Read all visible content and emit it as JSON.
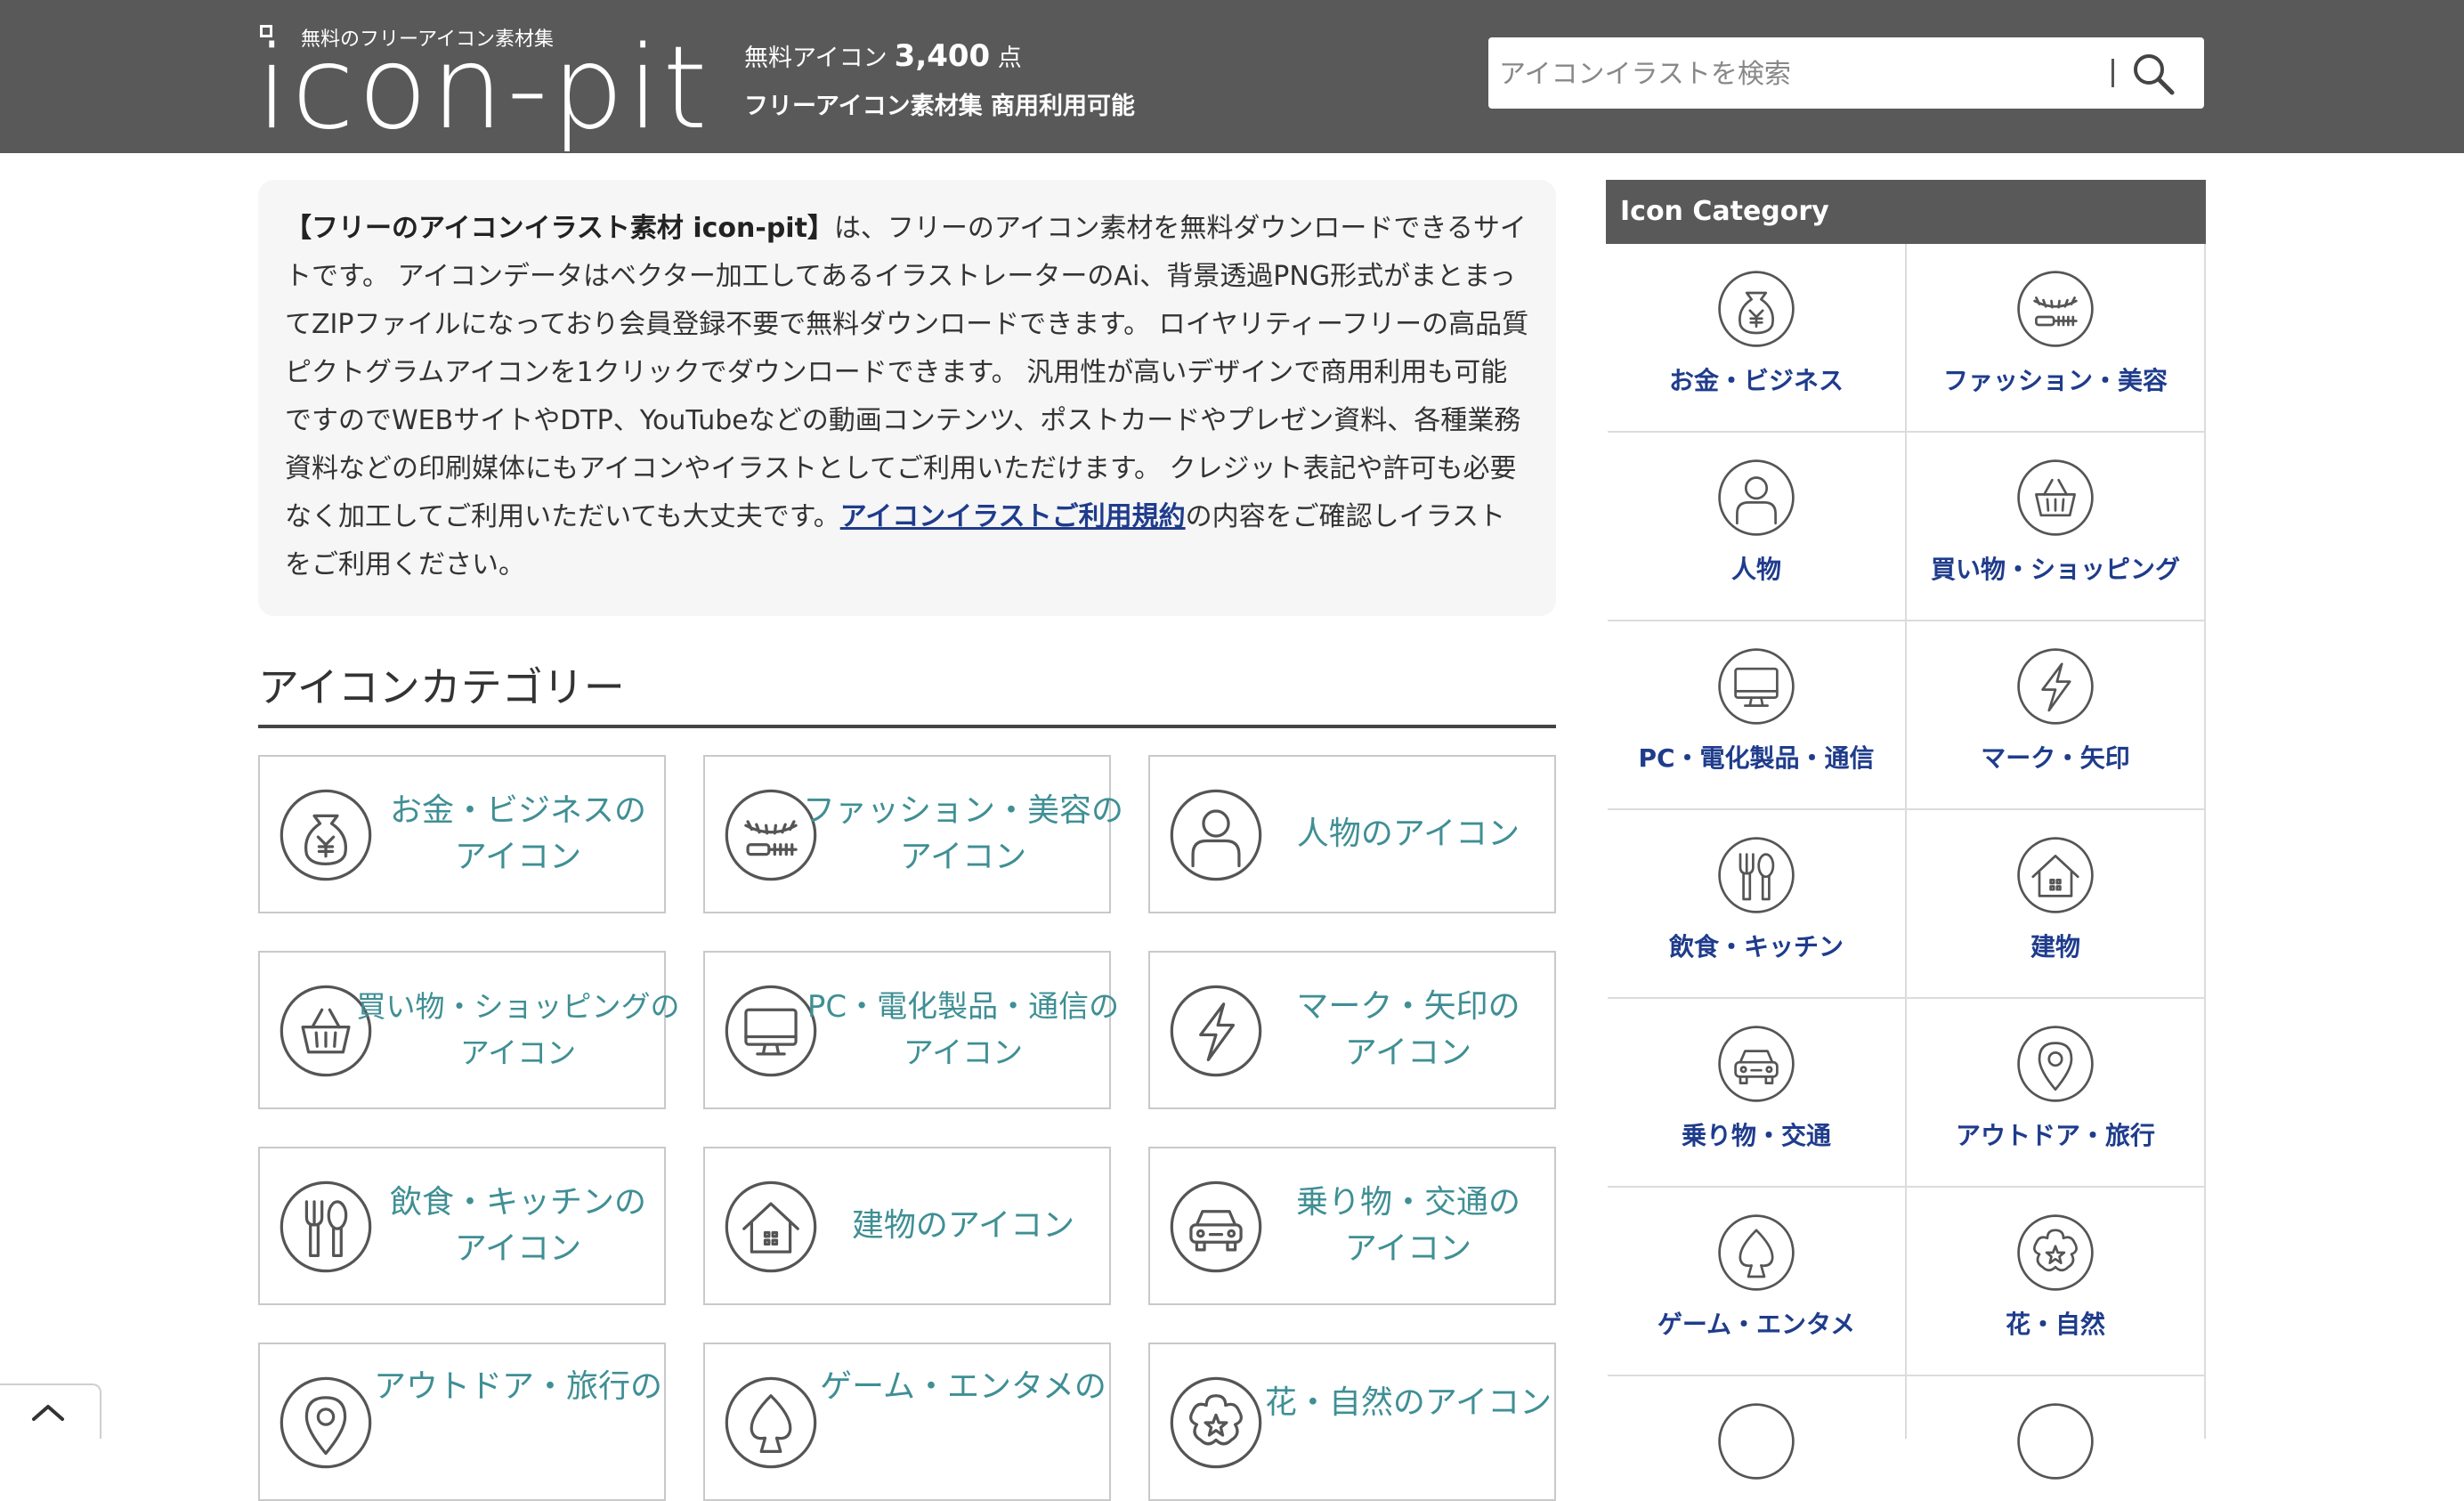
{
  "header": {
    "logo_tagline": "無料のフリーアイコン素材集",
    "logo_text": "icon-pit",
    "count_label": "無料アイコン",
    "count_value": "3,400",
    "count_unit": "点",
    "subline": "フリーアイコン素材集 商用利用可能",
    "search_placeholder": "アイコンイラストを検索"
  },
  "intro": {
    "lead_bold": "【フリーのアイコンイラスト素材 icon-pit】",
    "body_1": "は、フリーのアイコン素材を無料ダウンロードできるサイトです。 アイコンデータはベクター加工してあるイラストレーターのAi、背景透過PNG形式がまとまってZIPファイルになっており会員登録不要で無料ダウンロードできます。 ロイヤリティーフリーの高品質ピクトグラムアイコンを1クリックでダウンロードできます。 汎用性が高いデザインで商用利用も可能ですのでWEBサイトやDTP、YouTubeなどの動画コンテンツ、ポストカードやプレゼン資料、各種業務資料などの印刷媒体にもアイコンやイラストとしてご利用いただけます。 クレジット表記や許可も必要なく加工してご利用いただいても大丈夫です。",
    "link_text": "アイコンイラストご利用規約",
    "body_2": "の内容をご確認しイラストをご利用ください。"
  },
  "section_title": "アイコンカテゴリー",
  "main_categories": [
    {
      "line1": "お金・ビジネスの",
      "line2": "アイコン",
      "icon": "money-bag-icon"
    },
    {
      "line1": "ファッション・美容の",
      "line2": "アイコン",
      "icon": "eyelash-icon"
    },
    {
      "line1": "人物のアイコン",
      "line2": "",
      "icon": "person-icon"
    },
    {
      "line1": "買い物・ショッピングの",
      "line2": "アイコン",
      "icon": "basket-icon"
    },
    {
      "line1": "PC・電化製品・通信の",
      "line2": "アイコン",
      "icon": "monitor-icon"
    },
    {
      "line1": "マーク・矢印の",
      "line2": "アイコン",
      "icon": "lightning-icon"
    },
    {
      "line1": "飲食・キッチンの",
      "line2": "アイコン",
      "icon": "fork-spoon-icon"
    },
    {
      "line1": "建物のアイコン",
      "line2": "",
      "icon": "house-icon"
    },
    {
      "line1": "乗り物・交通の",
      "line2": "アイコン",
      "icon": "car-icon"
    },
    {
      "line1": "アウトドア・旅行の",
      "line2": "",
      "icon": "map-pin-icon"
    },
    {
      "line1": "ゲーム・エンタメの",
      "line2": "",
      "icon": "spade-icon"
    },
    {
      "line1": "花・自然のアイコン",
      "line2": "",
      "icon": "flower-icon"
    }
  ],
  "sidebar": {
    "title": "Icon Category",
    "items": [
      {
        "label": "お金・ビジネス",
        "icon": "money-bag-icon"
      },
      {
        "label": "ファッション・美容",
        "icon": "eyelash-icon"
      },
      {
        "label": "人物",
        "icon": "person-icon"
      },
      {
        "label": "買い物・ショッピング",
        "icon": "basket-icon"
      },
      {
        "label": "PC・電化製品・通信",
        "icon": "monitor-icon"
      },
      {
        "label": "マーク・矢印",
        "icon": "lightning-icon"
      },
      {
        "label": "飲食・キッチン",
        "icon": "fork-spoon-icon"
      },
      {
        "label": "建物",
        "icon": "house-icon"
      },
      {
        "label": "乗り物・交通",
        "icon": "car-icon"
      },
      {
        "label": "アウトドア・旅行",
        "icon": "map-pin-icon"
      },
      {
        "label": "ゲーム・エンタメ",
        "icon": "spade-icon"
      },
      {
        "label": "花・自然",
        "icon": "flower-icon"
      },
      {
        "label": "",
        "icon": "partial-icon"
      },
      {
        "label": "",
        "icon": "partial-icon"
      }
    ]
  },
  "colors": {
    "header_bg": "#595959",
    "teal_label": "#3f8f94",
    "navy_label": "#1f3c8c",
    "intro_bg": "#f6f6f6"
  }
}
